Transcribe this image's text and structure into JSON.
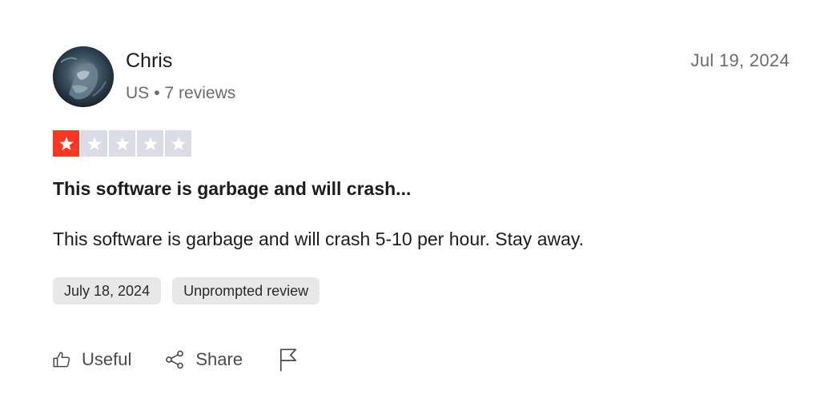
{
  "author": {
    "name": "Chris",
    "country": "US",
    "separator": "•",
    "reviews_count": "7 reviews"
  },
  "review": {
    "date_posted": "Jul 19, 2024",
    "rating": 1,
    "rating_max": 5,
    "title": "This software is garbage and will crash...",
    "body": "This software is garbage and will crash 5-10 per hour. Stay away.",
    "tags": [
      "July 18, 2024",
      "Unprompted review"
    ]
  },
  "actions": {
    "useful_label": "Useful",
    "share_label": "Share",
    "report_icon": "flag-icon"
  },
  "colors": {
    "star_filled": "#ff3722",
    "star_empty": "#dcdce6",
    "tag_bg": "#e8e8e8",
    "muted_text": "#6b6b6b"
  }
}
